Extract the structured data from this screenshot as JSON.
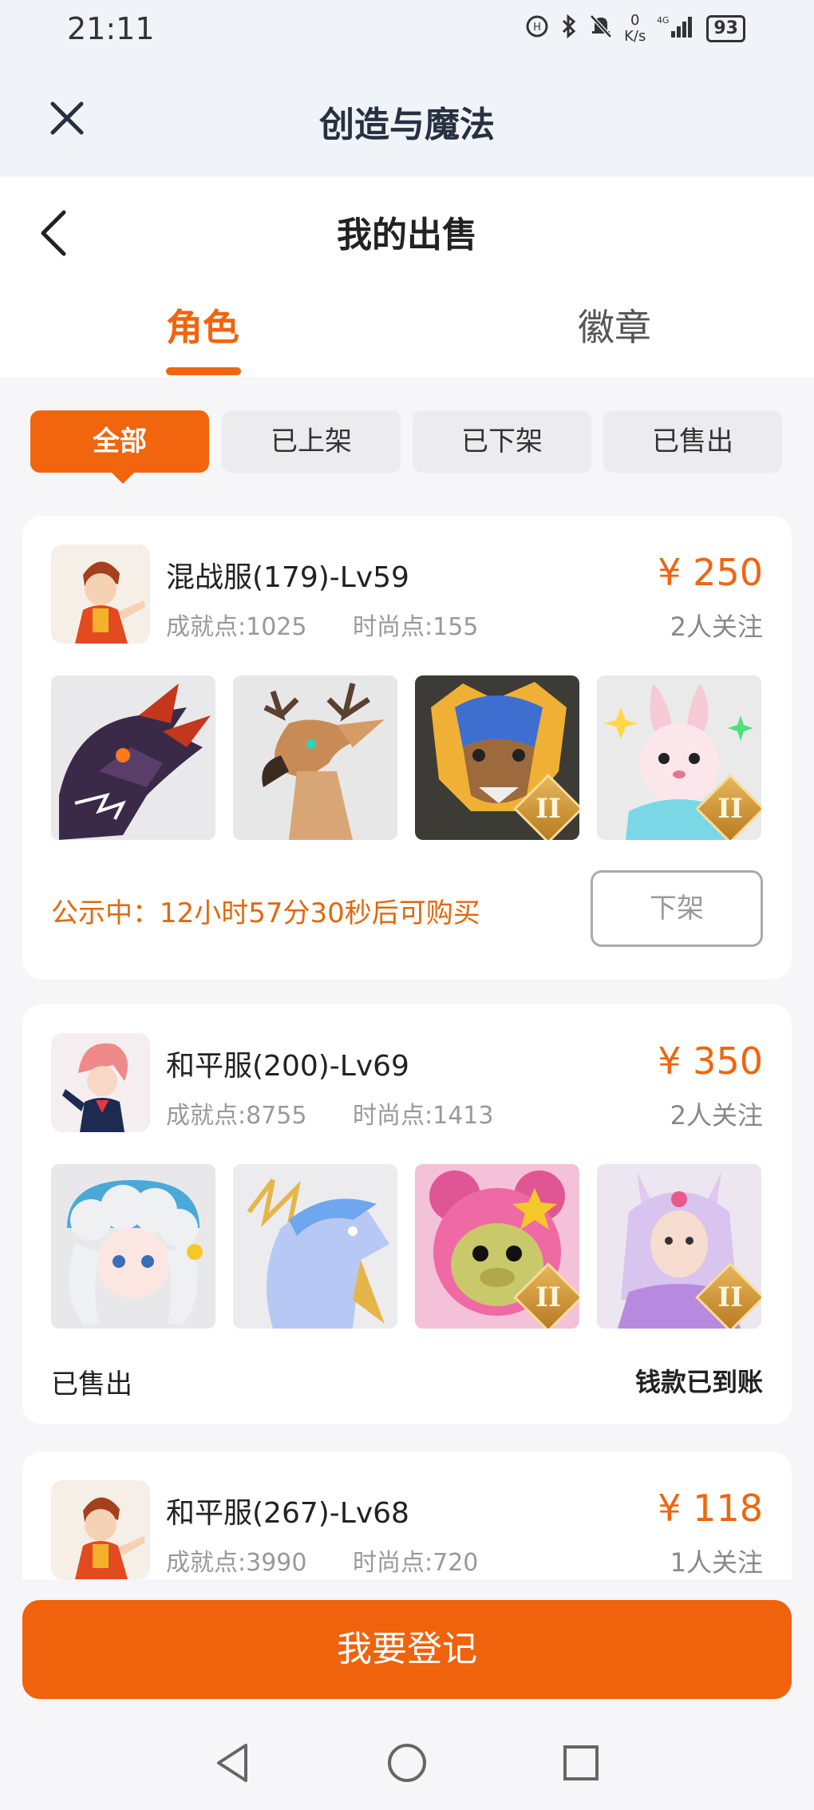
{
  "status": {
    "time": "21:11",
    "speed_value": "0",
    "speed_unit": "K/s",
    "network": "4G",
    "battery": "93"
  },
  "app": {
    "title": "创造与魔法"
  },
  "page": {
    "title": "我的出售"
  },
  "tabs": [
    {
      "label": "角色",
      "active": true
    },
    {
      "label": "徽章",
      "active": false
    }
  ],
  "filters": [
    {
      "label": "全部",
      "active": true
    },
    {
      "label": "已上架"
    },
    {
      "label": "已下架"
    },
    {
      "label": "已售出"
    }
  ],
  "listings": [
    {
      "name": "混战服(179)-Lv59",
      "achievement": "成就点:1025",
      "fashion": "时尚点:155",
      "price": "¥ 250",
      "followers": "2人关注",
      "thumbs": [
        "dragon-mount",
        "deer-mount",
        "wolf-mount",
        "rabbit-pet"
      ],
      "notice": "公示中：12小时57分30秒后可购买",
      "action": "下架"
    },
    {
      "name": "和平服(200)-Lv69",
      "achievement": "成就点:8755",
      "fashion": "时尚点:1413",
      "price": "¥ 350",
      "followers": "2人关注",
      "thumbs": [
        "cloud-doll-pet",
        "ice-horse-mount",
        "pink-bear-pet",
        "fox-spirit-pet"
      ],
      "status": "已售出",
      "settlement": "钱款已到账"
    },
    {
      "name": "和平服(267)-Lv68",
      "achievement": "成就点:3990",
      "fashion": "时尚点:720",
      "price": "¥ 118",
      "followers": "1人关注"
    }
  ],
  "tier_badge": "II",
  "bottom": {
    "register_label": "我要登记"
  },
  "colors": {
    "accent": "#f0650d",
    "background": "#f6f6f8"
  }
}
